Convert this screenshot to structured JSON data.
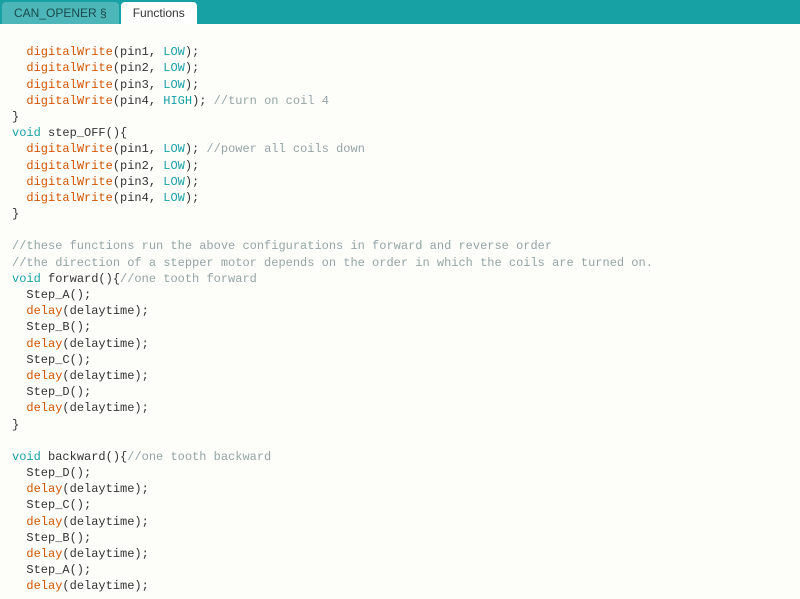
{
  "tabs": {
    "inactive": "CAN_OPENER §",
    "active": "Functions"
  },
  "code": {
    "l01_fn": "digitalWrite",
    "l01_args": "(pin1, ",
    "l01_con": "LOW",
    "l01_end": ");",
    "l02_fn": "digitalWrite",
    "l02_args": "(pin2, ",
    "l02_con": "LOW",
    "l02_end": ");",
    "l03_fn": "digitalWrite",
    "l03_args": "(pin3, ",
    "l03_con": "LOW",
    "l03_end": ");",
    "l04_fn": "digitalWrite",
    "l04_args": "(pin4, ",
    "l04_con": "HIGH",
    "l04_end": "); ",
    "l04_cm": "//turn on coil 4",
    "l05": "}",
    "l06_kw": "void",
    "l06_sig": " step_OFF(){",
    "l07_fn": "digitalWrite",
    "l07_args": "(pin1, ",
    "l07_con": "LOW",
    "l07_end": "); ",
    "l07_cm": "//power all coils down",
    "l08_fn": "digitalWrite",
    "l08_args": "(pin2, ",
    "l08_con": "LOW",
    "l08_end": ");",
    "l09_fn": "digitalWrite",
    "l09_args": "(pin3, ",
    "l09_con": "LOW",
    "l09_end": ");",
    "l10_fn": "digitalWrite",
    "l10_args": "(pin4, ",
    "l10_con": "LOW",
    "l10_end": ");",
    "l11": "}",
    "l12": "",
    "l13_cm": "//these functions run the above configurations in forward and reverse order",
    "l14_cm": "//the direction of a stepper motor depends on the order in which the coils are turned on.",
    "l15_kw": "void",
    "l15_sig": " forward(){",
    "l15_cm": "//one tooth forward",
    "l16": "  Step_A();",
    "l17_fn": "delay",
    "l17_args": "(delaytime);",
    "l18": "  Step_B();",
    "l19_fn": "delay",
    "l19_args": "(delaytime);",
    "l20": "  Step_C();",
    "l21_fn": "delay",
    "l21_args": "(delaytime);",
    "l22": "  Step_D();",
    "l23_fn": "delay",
    "l23_args": "(delaytime);",
    "l24": "}",
    "l25": "",
    "l26_kw": "void",
    "l26_sig": " backward(){",
    "l26_cm": "//one tooth backward",
    "l27": "  Step_D();",
    "l28_fn": "delay",
    "l28_args": "(delaytime);",
    "l29": "  Step_C();",
    "l30_fn": "delay",
    "l30_args": "(delaytime);",
    "l31": "  Step_B();",
    "l32_fn": "delay",
    "l32_args": "(delaytime);",
    "l33": "  Step_A();",
    "l34_fn": "delay",
    "l34_args": "(delaytime);"
  }
}
